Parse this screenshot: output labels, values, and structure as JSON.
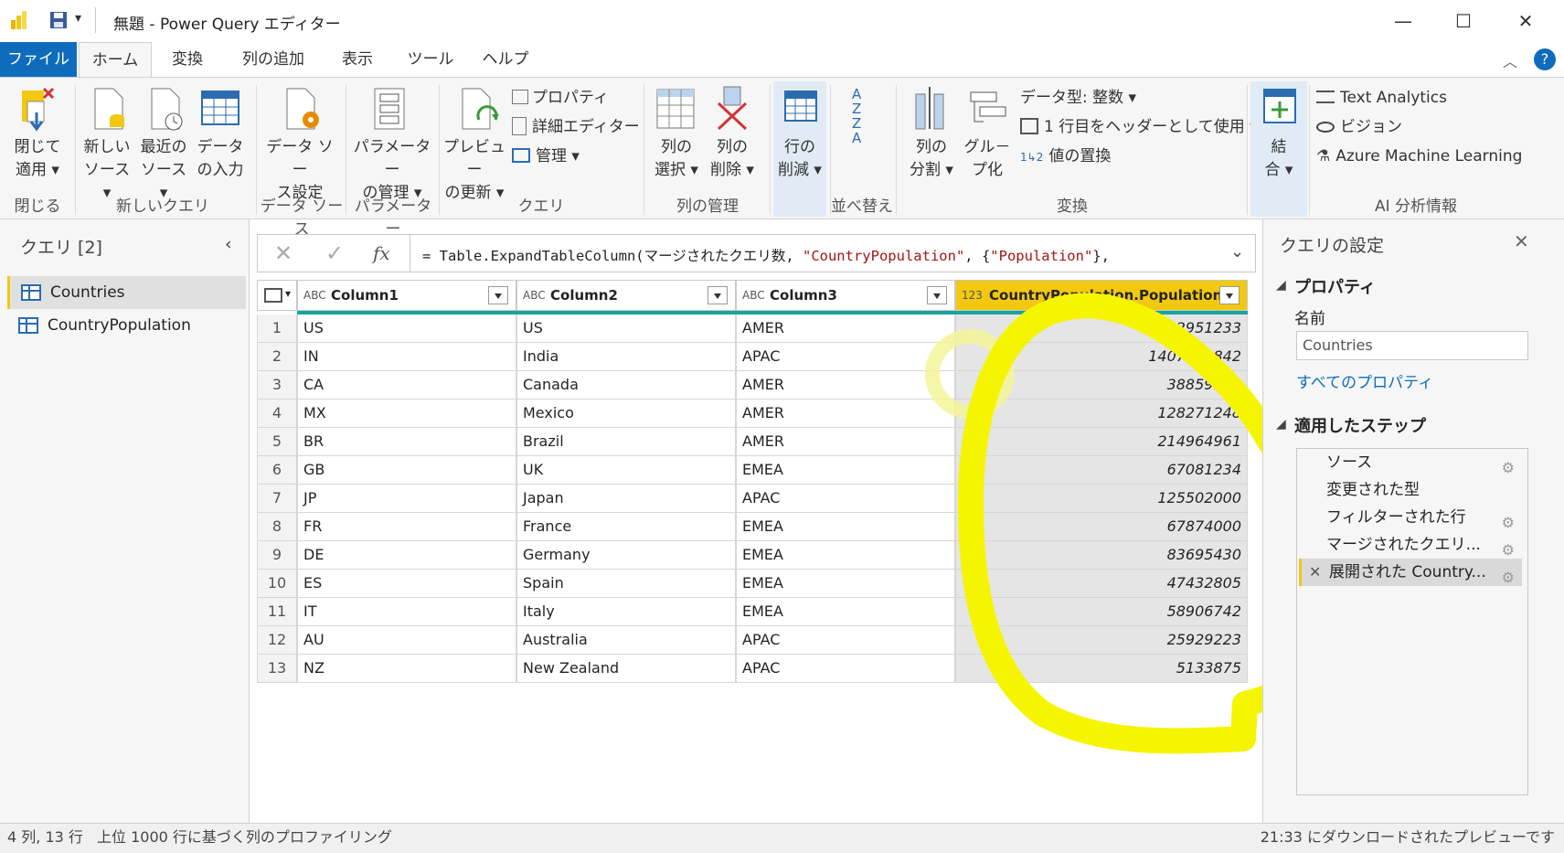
{
  "window": {
    "title": "無題 - Power Query エディター",
    "minimize": "—",
    "maximize": "☐",
    "close": "✕"
  },
  "menu": {
    "tabs": [
      "ファイル",
      "ホーム",
      "変換",
      "列の追加",
      "表示",
      "ツール",
      "ヘルプ"
    ],
    "help_icon": "?"
  },
  "ribbon": {
    "close_apply": [
      "閉じて",
      "適用 ▾"
    ],
    "new_source": [
      "新しい",
      "ソース ▾"
    ],
    "recent_source": [
      "最近の",
      "ソース ▾"
    ],
    "enter_data": [
      "データ",
      "の入力"
    ],
    "datasource_settings": [
      "データ ソー",
      "ス設定"
    ],
    "manage_params": [
      "パラメーター",
      "の管理 ▾"
    ],
    "refresh_preview": [
      "プレビュー",
      "の更新 ▾"
    ],
    "properties": "プロパティ",
    "advanced_editor": "詳細エディター",
    "manage": "管理 ▾",
    "choose_columns": [
      "列の",
      "選択 ▾"
    ],
    "remove_columns": [
      "列の",
      "削除 ▾"
    ],
    "reduce_rows": [
      "行の",
      "削減 ▾"
    ],
    "split_column": [
      "列の",
      "分割 ▾"
    ],
    "group_by": [
      "グル－",
      "プ化"
    ],
    "data_type": "データ型: 整数 ▾",
    "use_first_row": "1 行目をヘッダーとして使用 ▾",
    "replace_values": "値の置換",
    "combine": [
      "結",
      "合 ▾"
    ],
    "text_analytics": "Text Analytics",
    "vision": "ビジョン",
    "azure_ml": "Azure Machine Learning",
    "groups": {
      "close": "閉じる",
      "new_query": "新しいクエリ",
      "data_source": "データ ソース",
      "parameters": "パラメーター",
      "query": "クエリ",
      "manage_columns": "列の管理",
      "sort": "並べ替え",
      "transform": "変換",
      "ai": "AI 分析情報"
    }
  },
  "queries_pane": {
    "title": "クエリ [2]",
    "items": [
      "Countries",
      "CountryPopulation"
    ]
  },
  "formula": {
    "fx": "fx",
    "prefix": "= Table.ExpandTableColumn(マージされたクエリ数, ",
    "arg1": "\"CountryPopulation\"",
    "sep": ", {",
    "arg2": "\"Population\"",
    "suffix": "},"
  },
  "table": {
    "columns": [
      {
        "type": "ABC",
        "name": "Column1"
      },
      {
        "type": "ABC",
        "name": "Column2"
      },
      {
        "type": "ABC",
        "name": "Column3"
      },
      {
        "type": "123",
        "name": "CountryPopulation.Population"
      }
    ],
    "rows": [
      [
        "1",
        "US",
        "US",
        "AMER",
        "332951233"
      ],
      [
        "2",
        "IN",
        "India",
        "APAC",
        "1407563842"
      ],
      [
        "3",
        "CA",
        "Canada",
        "AMER",
        "38859154"
      ],
      [
        "4",
        "MX",
        "Mexico",
        "AMER",
        "128271248"
      ],
      [
        "5",
        "BR",
        "Brazil",
        "AMER",
        "214964961"
      ],
      [
        "6",
        "GB",
        "UK",
        "EMEA",
        "67081234"
      ],
      [
        "7",
        "JP",
        "Japan",
        "APAC",
        "125502000"
      ],
      [
        "8",
        "FR",
        "France",
        "EMEA",
        "67874000"
      ],
      [
        "9",
        "DE",
        "Germany",
        "EMEA",
        "83695430"
      ],
      [
        "10",
        "ES",
        "Spain",
        "EMEA",
        "47432805"
      ],
      [
        "11",
        "IT",
        "Italy",
        "EMEA",
        "58906742"
      ],
      [
        "12",
        "AU",
        "Australia",
        "APAC",
        "25929223"
      ],
      [
        "13",
        "NZ",
        "New Zealand",
        "APAC",
        "5133875"
      ]
    ]
  },
  "settings_pane": {
    "title": "クエリの設定",
    "properties_header": "プロパティ",
    "name_label": "名前",
    "name_value": "Countries",
    "all_properties": "すべてのプロパティ",
    "steps_header": "適用したステップ",
    "steps": [
      "ソース",
      "変更された型",
      "フィルターされた行",
      "マージされたクエリ...",
      "展開された Country..."
    ]
  },
  "status": {
    "left": "4 列, 13 行",
    "profiling": "上位 1000 行に基づく列のプロファイリング",
    "right": "21:33 にダウンロードされたプレビューです"
  },
  "colors": {
    "accent": "#0f6cbd",
    "selected_header": "#f2c811",
    "highlight": "#f5f500",
    "link": "#0f6cbd"
  }
}
